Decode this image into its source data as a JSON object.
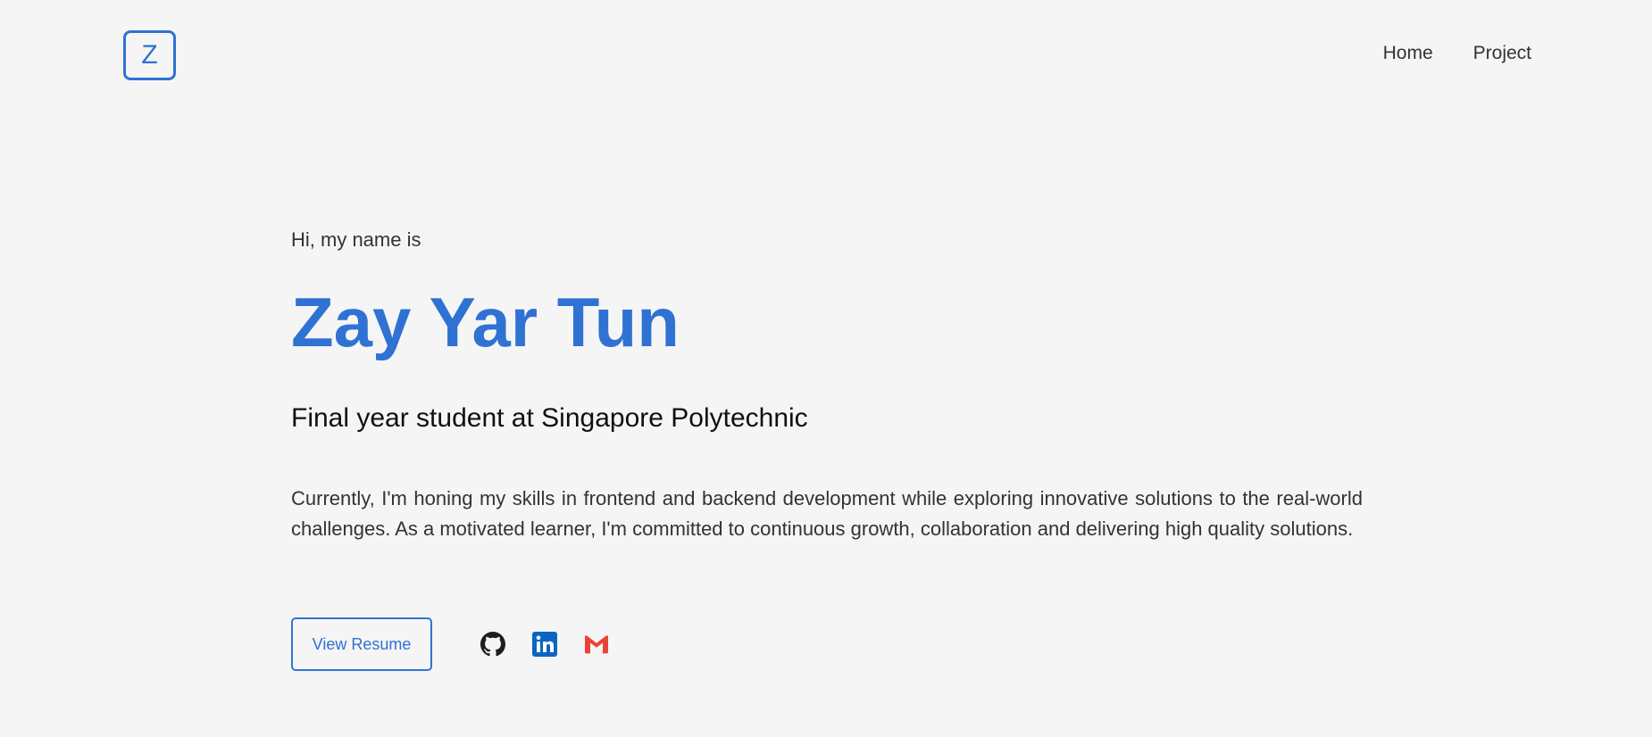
{
  "header": {
    "logo_letter": "Z",
    "nav": [
      {
        "label": "Home"
      },
      {
        "label": "Project"
      }
    ]
  },
  "hero": {
    "greeting": "Hi, my name is",
    "name": "Zay Yar Tun",
    "subtitle": "Final year student at Singapore Polytechnic",
    "description": "Currently, I'm honing my skills in frontend and backend development while exploring innovative solutions to the real-world challenges. As a motivated learner, I'm committed to continuous growth, collaboration and delivering high quality solutions.",
    "resume_label": "View Resume",
    "socials": [
      {
        "icon": "github-icon"
      },
      {
        "icon": "linkedin-icon"
      },
      {
        "icon": "gmail-icon"
      }
    ]
  },
  "colors": {
    "accent": "#2f72d3",
    "background": "#f5f5f5",
    "text": "#333333",
    "linkedin": "#0a66c2",
    "gmail": "#ea4335"
  }
}
